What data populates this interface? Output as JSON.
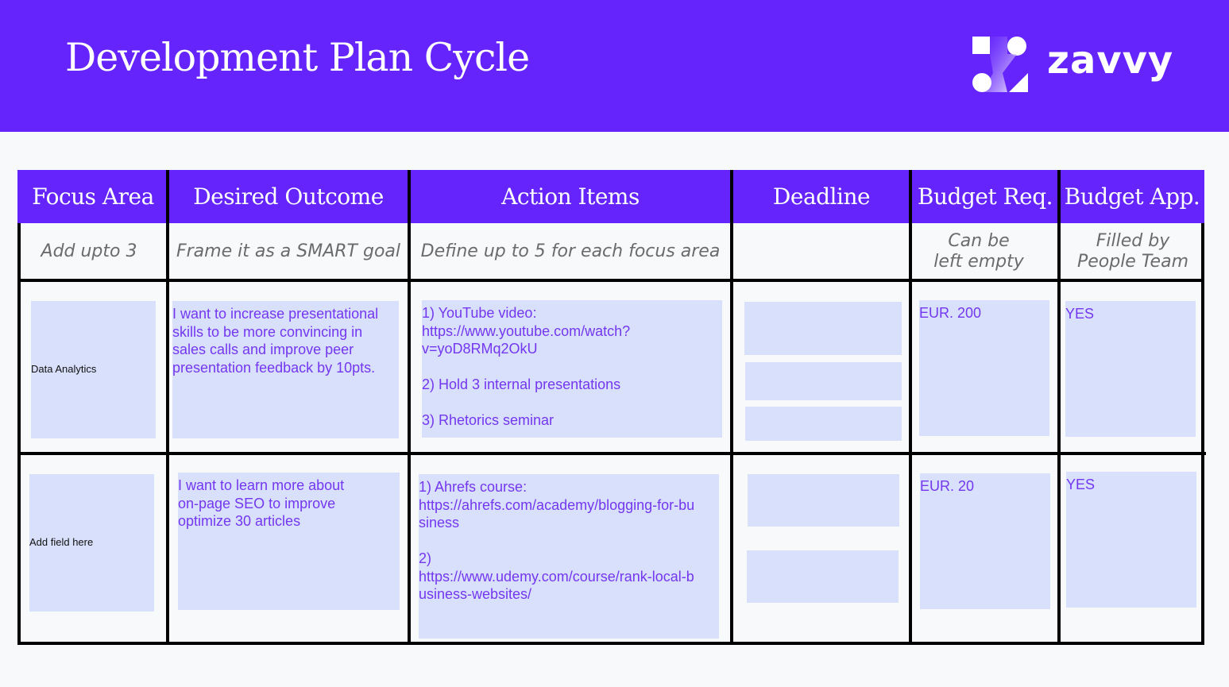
{
  "header": {
    "title": "Development Plan Cycle",
    "brand": "zavvy",
    "brand_icon": "zavvy-logo-mark-icon"
  },
  "colors": {
    "brand": "#6424fb",
    "cell_fill": "#d9e0fb",
    "cell_text": "#7337f0",
    "background": "#f8f9fb"
  },
  "table": {
    "columns": [
      {
        "label": "Focus Area",
        "hint": "Add upto 3"
      },
      {
        "label": "Desired Outcome",
        "hint": "Frame it as a SMART goal"
      },
      {
        "label": "Action Items",
        "hint": "Define up to 5 for each focus area"
      },
      {
        "label": "Deadline",
        "hint": ""
      },
      {
        "label": "Budget Req.",
        "hint": "Can be\nleft empty"
      },
      {
        "label": "Budget App.",
        "hint": "Filled by\nPeople Team"
      }
    ],
    "rows": [
      {
        "focus_area": "Data Analytics",
        "desired_outcome": "I want to increase presentational skills to be more convincing in sales calls and improve peer presentation feedback by 10pts.",
        "action_items": "1) YouTube video:\nhttps://www.youtube.com/watch?\nv=yoD8RMq2OkU\n\n2) Hold 3 internal presentations\n\n3) Rhetorics seminar",
        "deadlines": [
          "",
          "",
          ""
        ],
        "budget_requested": "EUR. 200",
        "budget_approved": "YES"
      },
      {
        "focus_area": "Add field here",
        "desired_outcome": "I want to learn more about\non-page SEO to improve\noptimize 30 articles",
        "action_items": "1) Ahrefs course:\nhttps://ahrefs.com/academy/blogging-for-bu\nsiness\n\n2)\nhttps://www.udemy.com/course/rank-local-b\nusiness-websites/",
        "deadlines": [
          "",
          ""
        ],
        "budget_requested": "EUR. 20",
        "budget_approved": "YES"
      }
    ]
  }
}
